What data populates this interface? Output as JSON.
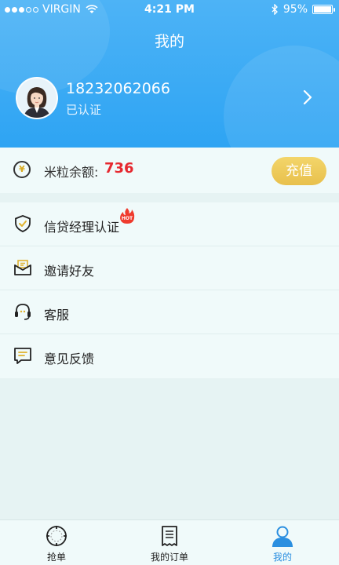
{
  "status_bar": {
    "carrier": "VIRGIN",
    "time": "4:21 PM",
    "battery": "95%"
  },
  "header": {
    "title": "我的"
  },
  "profile": {
    "phone": "18232062066",
    "status": "已认证"
  },
  "balance": {
    "label": "米粒余额:",
    "value": "736",
    "recharge_label": "充值"
  },
  "menu": {
    "items": [
      {
        "label": "信贷经理认证",
        "icon": "shield-check-icon",
        "badge": "HOT"
      },
      {
        "label": "邀请好友",
        "icon": "envelope-icon"
      },
      {
        "label": "客服",
        "icon": "headset-icon"
      },
      {
        "label": "意见反馈",
        "icon": "feedback-icon"
      }
    ]
  },
  "tabbar": {
    "tabs": [
      {
        "label": "抢单",
        "icon": "grab-order-icon"
      },
      {
        "label": "我的订单",
        "icon": "order-list-icon"
      },
      {
        "label": "我的",
        "icon": "user-icon",
        "active": true
      }
    ]
  },
  "colors": {
    "header_blue": "#2ea4f3",
    "accent_red": "#e6282f",
    "recharge_gold": "#e8c04c",
    "active_tab": "#2b8fe0"
  }
}
